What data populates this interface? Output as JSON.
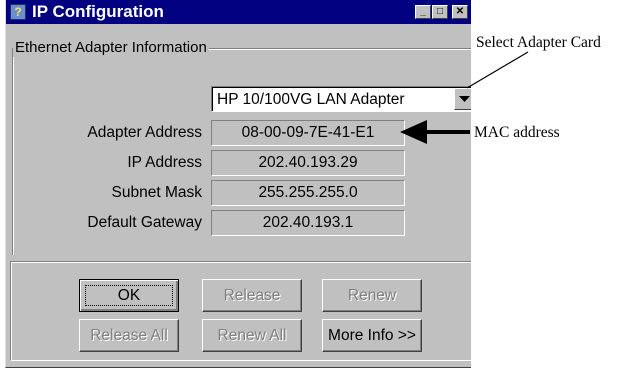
{
  "window": {
    "title": "IP Configuration",
    "controls": {
      "minimize": "_",
      "maximize": "□",
      "close": "✕"
    },
    "icon": "network-help-icon"
  },
  "adapter_info": {
    "group_label": "Ethernet  Adapter Information",
    "selected_adapter": "HP 10/100VG LAN Adapter",
    "fields": [
      {
        "label": "Adapter Address",
        "value": "08-00-09-7E-41-E1"
      },
      {
        "label": "IP Address",
        "value": "202.40.193.29"
      },
      {
        "label": "Subnet Mask",
        "value": "255.255.255.0"
      },
      {
        "label": "Default Gateway",
        "value": "202.40.193.1"
      }
    ]
  },
  "buttons": {
    "ok": "OK",
    "release": "Release",
    "renew": "Renew",
    "release_all": "Release All",
    "renew_all": "Renew All",
    "more_info": "More Info >>"
  },
  "annotations": {
    "select_adapter": "Select Adapter Card",
    "mac_address": "MAC address"
  },
  "colors": {
    "titlebar": "#000080",
    "face": "#c0c0c0",
    "disabled_text": "#808080"
  }
}
